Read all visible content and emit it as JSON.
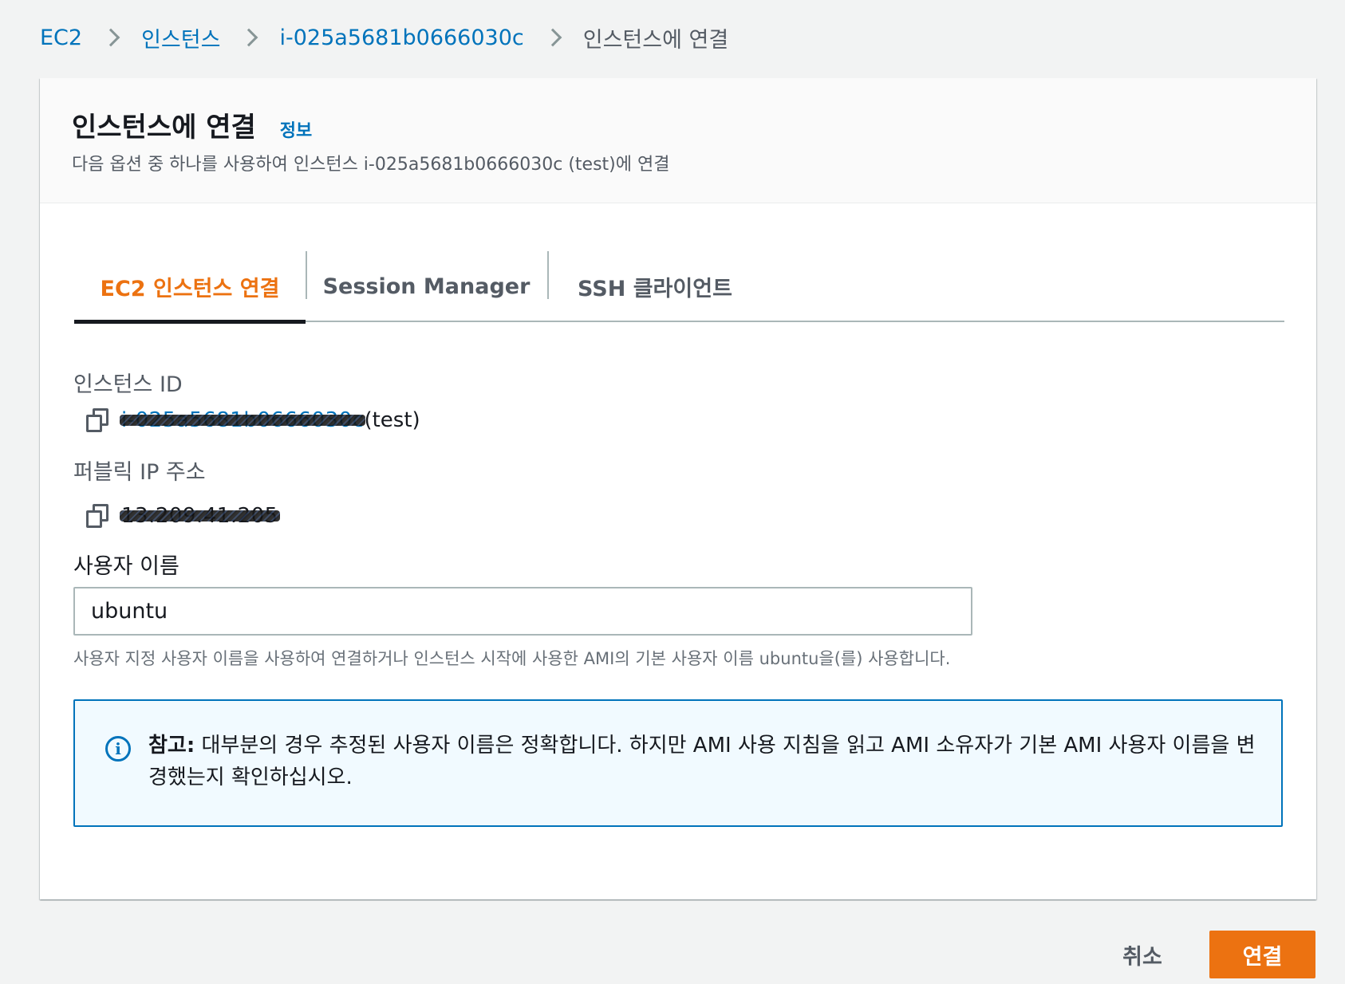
{
  "breadcrumb": {
    "items": [
      "EC2",
      "인스턴스",
      "i-025a5681b0666030c"
    ],
    "current": "인스턴스에 연결"
  },
  "header": {
    "title": "인스턴스에 연결",
    "info_link": "정보",
    "subtitle": "다음 옵션 중 하나를 사용하여 인스턴스 i-025a5681b0666030c (test)에 연결"
  },
  "tabs": [
    {
      "label": "EC2 인스턴스 연결",
      "active": true
    },
    {
      "label": "Session Manager",
      "active": false
    },
    {
      "label": "SSH 클라이언트",
      "active": false
    }
  ],
  "instance": {
    "label": "인스턴스 ID",
    "value_redacted": "i-025a5681b0666030c",
    "suffix": "(test)"
  },
  "public_ip": {
    "label": "퍼블릭 IP 주소",
    "value_redacted": "13.209.41.205"
  },
  "username": {
    "label": "사용자 이름",
    "value": "ubuntu",
    "hint": "사용자 지정 사용자 이름을 사용하여 연결하거나 인스턴스 시작에 사용한 AMI의 기본 사용자 이름 ubuntu을(를) 사용합니다."
  },
  "alert": {
    "prefix": "참고:",
    "text": " 대부분의 경우 추정된 사용자 이름은 정확합니다. 하지만 AMI 사용 지침을 읽고 AMI 소유자가 기본 AMI 사용자 이름을 변경했는지 확인하십시오."
  },
  "actions": {
    "cancel": "취소",
    "connect": "연결"
  },
  "colors": {
    "link": "#0073bb",
    "accent": "#ec7211",
    "background": "#f2f3f3"
  }
}
